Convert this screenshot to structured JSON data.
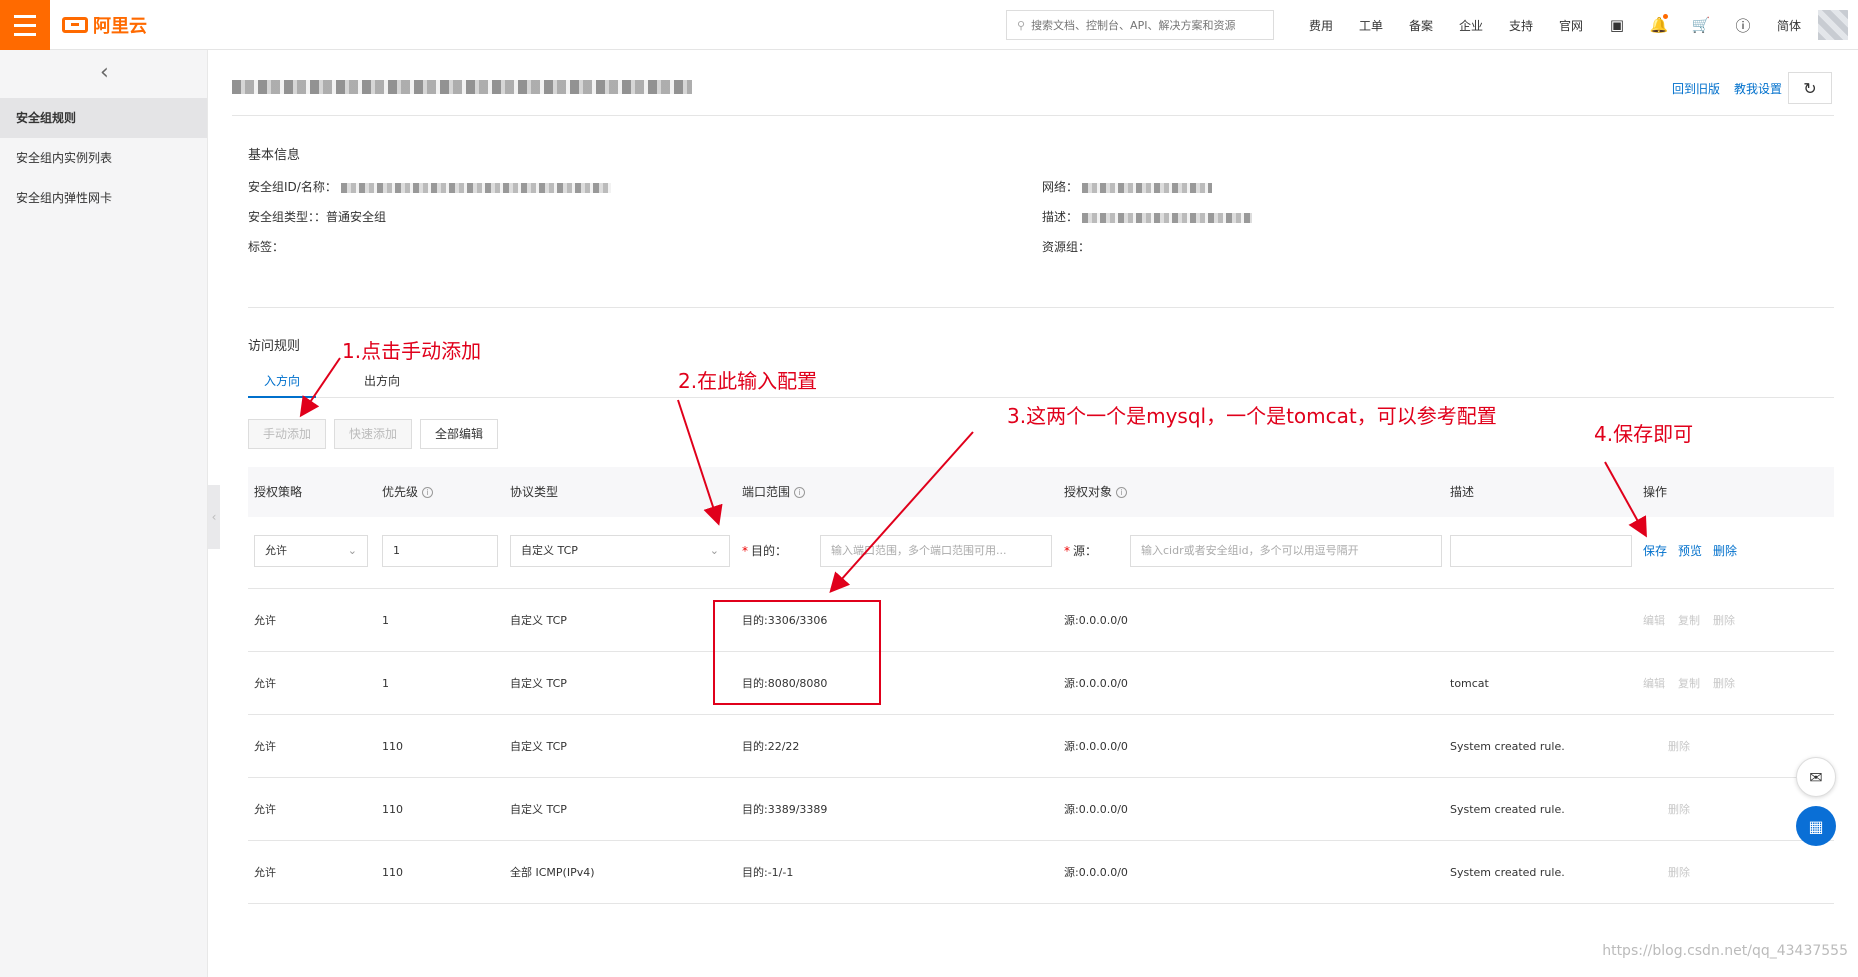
{
  "header": {
    "brand": "阿里云",
    "search_placeholder": "搜索文档、控制台、API、解决方案和资源",
    "nav": [
      "费用",
      "工单",
      "备案",
      "企业",
      "支持",
      "官网"
    ],
    "lang": "简体"
  },
  "sidebar": {
    "items": [
      {
        "label": "安全组规则",
        "active": true
      },
      {
        "label": "安全组内实例列表"
      },
      {
        "label": "安全组内弹性网卡"
      }
    ]
  },
  "page": {
    "links": [
      "回到旧版",
      "教我设置"
    ]
  },
  "basic_info": {
    "title": "基本信息",
    "id_label": "安全组ID/名称：",
    "type_label": "安全组类型：",
    "type_value": "：普通安全组",
    "tag_label": "标签：",
    "network_label": "网络：",
    "desc_label": "描述：",
    "resgroup_label": "资源组："
  },
  "rules": {
    "title": "访问规则",
    "tabs": [
      "入方向",
      "出方向"
    ],
    "buttons": [
      "手动添加",
      "快速添加",
      "全部编辑"
    ],
    "columns": [
      "授权策略",
      "优先级",
      "协议类型",
      "端口范围",
      "授权对象",
      "描述",
      "操作"
    ],
    "edit_row": {
      "policy": "允许",
      "priority": "1",
      "protocol": "自定义 TCP",
      "dest_label": "目的：",
      "dest_placeholder": "输入端口范围，多个端口范围可用...",
      "src_label": "源：",
      "src_placeholder": "输入cidr或者安全组id，多个可以用逗号隔开",
      "actions": [
        "保存",
        "预览",
        "删除"
      ]
    },
    "rows": [
      {
        "policy": "允许",
        "priority": "1",
        "protocol": "自定义 TCP",
        "port": "目的:3306/3306",
        "source": "源:0.0.0.0/0",
        "desc": "",
        "actions": [
          "编辑",
          "复制",
          "删除"
        ]
      },
      {
        "policy": "允许",
        "priority": "1",
        "protocol": "自定义 TCP",
        "port": "目的:8080/8080",
        "source": "源:0.0.0.0/0",
        "desc": "tomcat",
        "actions": [
          "编辑",
          "复制",
          "删除"
        ]
      },
      {
        "policy": "允许",
        "priority": "110",
        "protocol": "自定义 TCP",
        "port": "目的:22/22",
        "source": "源:0.0.0.0/0",
        "desc": "System created rule.",
        "actions": [
          "删除"
        ]
      },
      {
        "policy": "允许",
        "priority": "110",
        "protocol": "自定义 TCP",
        "port": "目的:3389/3389",
        "source": "源:0.0.0.0/0",
        "desc": "System created rule.",
        "actions": [
          "删除"
        ]
      },
      {
        "policy": "允许",
        "priority": "110",
        "protocol": "全部 ICMP(IPv4)",
        "port": "目的:-1/-1",
        "source": "源:0.0.0.0/0",
        "desc": "System created rule.",
        "actions": [
          "删除"
        ]
      }
    ]
  },
  "annotations": {
    "step1": "1.点击手动添加",
    "step2": "2.在此输入配置",
    "step3": "3.这两个一个是mysql，一个是tomcat，可以参考配置",
    "step4": "4.保存即可",
    "color": "#e0001b"
  },
  "watermark": "https://blog.csdn.net/qq_43437555"
}
